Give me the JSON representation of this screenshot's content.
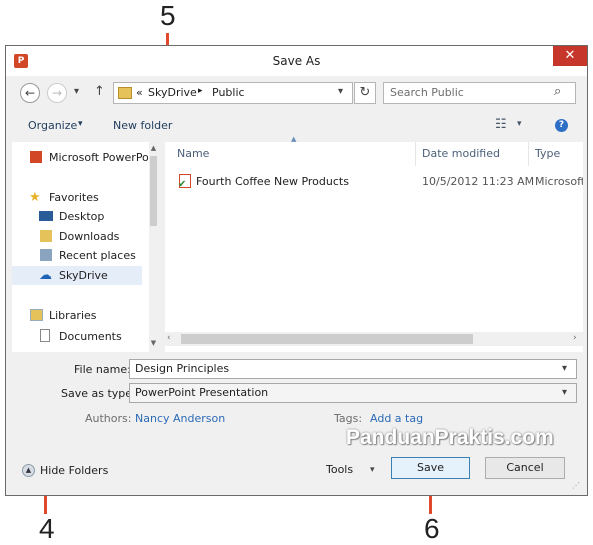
{
  "callouts": {
    "top": "5",
    "left_bottom": "4",
    "right_bottom": "6"
  },
  "window": {
    "title": "Save As",
    "close_glyph": "✕",
    "app_icon_letter": "P"
  },
  "nav": {
    "back_glyph": "←",
    "forward_glyph": "→",
    "dropdown_glyph": "▾",
    "up_glyph": "↑",
    "address": {
      "prefix": "«",
      "parts": [
        "SkyDrive",
        "Public"
      ],
      "separator": "▸",
      "refresh_glyph": "↻"
    },
    "search_placeholder": "Search Public",
    "search_glyph": "⌕"
  },
  "toolbar": {
    "organize_label": "Organize",
    "new_folder_label": "New folder",
    "help_glyph": "?",
    "view_glyph": "☷"
  },
  "sidebar": {
    "items": [
      {
        "label": "Microsoft PowerPo"
      },
      {
        "label": "Favorites"
      },
      {
        "label": "Desktop"
      },
      {
        "label": "Downloads"
      },
      {
        "label": "Recent places"
      },
      {
        "label": "SkyDrive"
      },
      {
        "label": "Libraries"
      },
      {
        "label": "Documents"
      }
    ]
  },
  "columns": {
    "name": "Name",
    "date": "Date modified",
    "type": "Type"
  },
  "files": [
    {
      "name": "Fourth Coffee New Products",
      "date": "10/5/2012 11:23 AM",
      "type": "Microsoft"
    }
  ],
  "form": {
    "filename_label": "File name:",
    "filename_value": "Design Principles",
    "savetype_label": "Save as type:",
    "savetype_value": "PowerPoint Presentation",
    "authors_label": "Authors:",
    "authors_value": "Nancy Anderson",
    "tags_label": "Tags:",
    "tags_value": "Add a tag"
  },
  "footer": {
    "hide_folders_label": "Hide Folders",
    "tools_label": "Tools",
    "save_label": "Save",
    "cancel_label": "Cancel"
  },
  "watermark": "PanduanPraktis.com",
  "colors": {
    "accent_line": "#e0492b",
    "link": "#2b6ab6",
    "selection": "#e5eef8"
  }
}
